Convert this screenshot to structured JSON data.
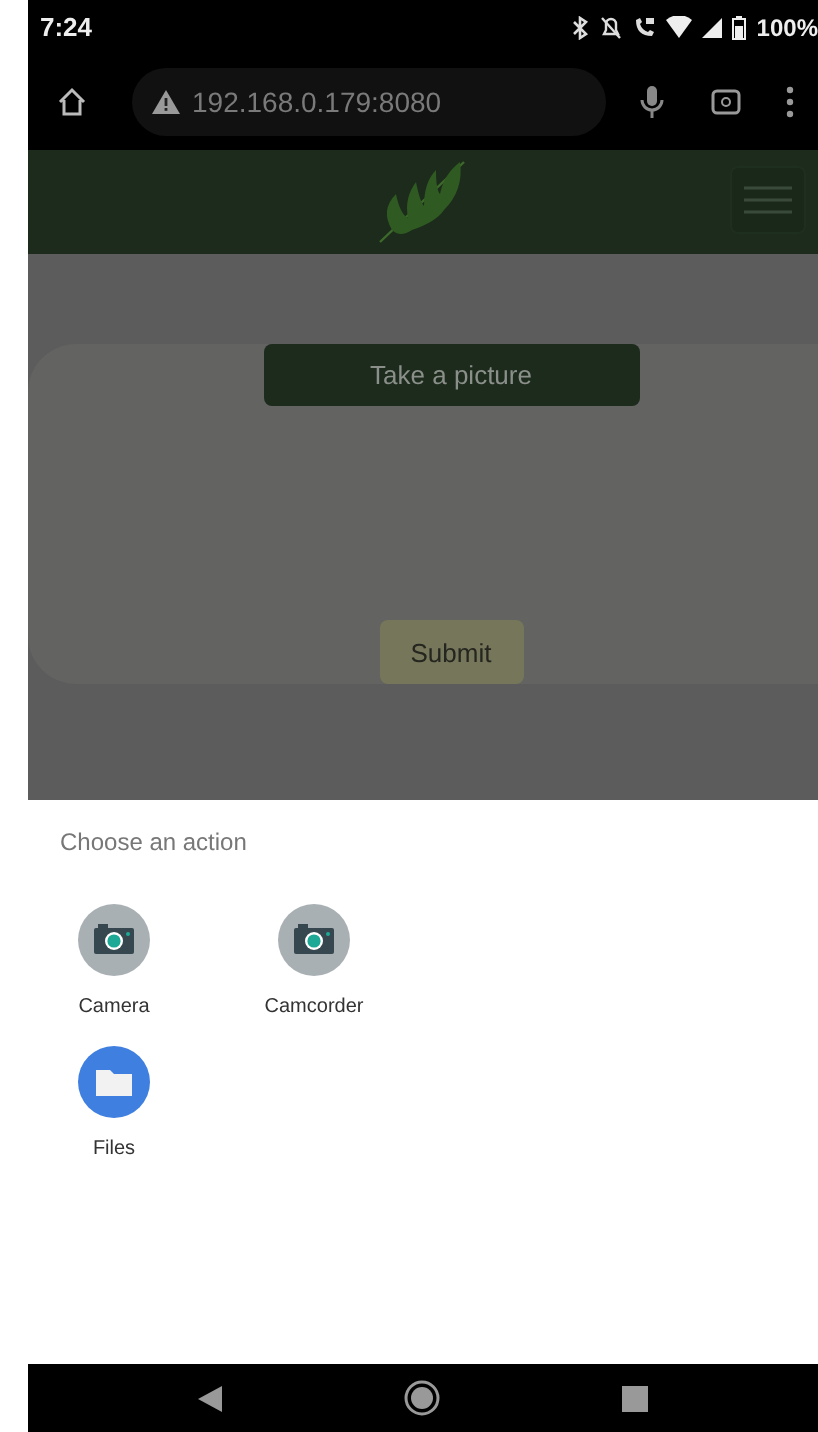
{
  "status_bar": {
    "time": "7:24",
    "battery": "100%"
  },
  "browser": {
    "url": "192.168.0.179:8080"
  },
  "page": {
    "take_picture_button": "Take a picture",
    "submit_button": "Submit"
  },
  "sheet": {
    "title": "Choose an action",
    "apps": [
      {
        "label": "Camera",
        "kind": "camera"
      },
      {
        "label": "Camcorder",
        "kind": "camera"
      },
      {
        "label": "Files",
        "kind": "files"
      }
    ]
  }
}
